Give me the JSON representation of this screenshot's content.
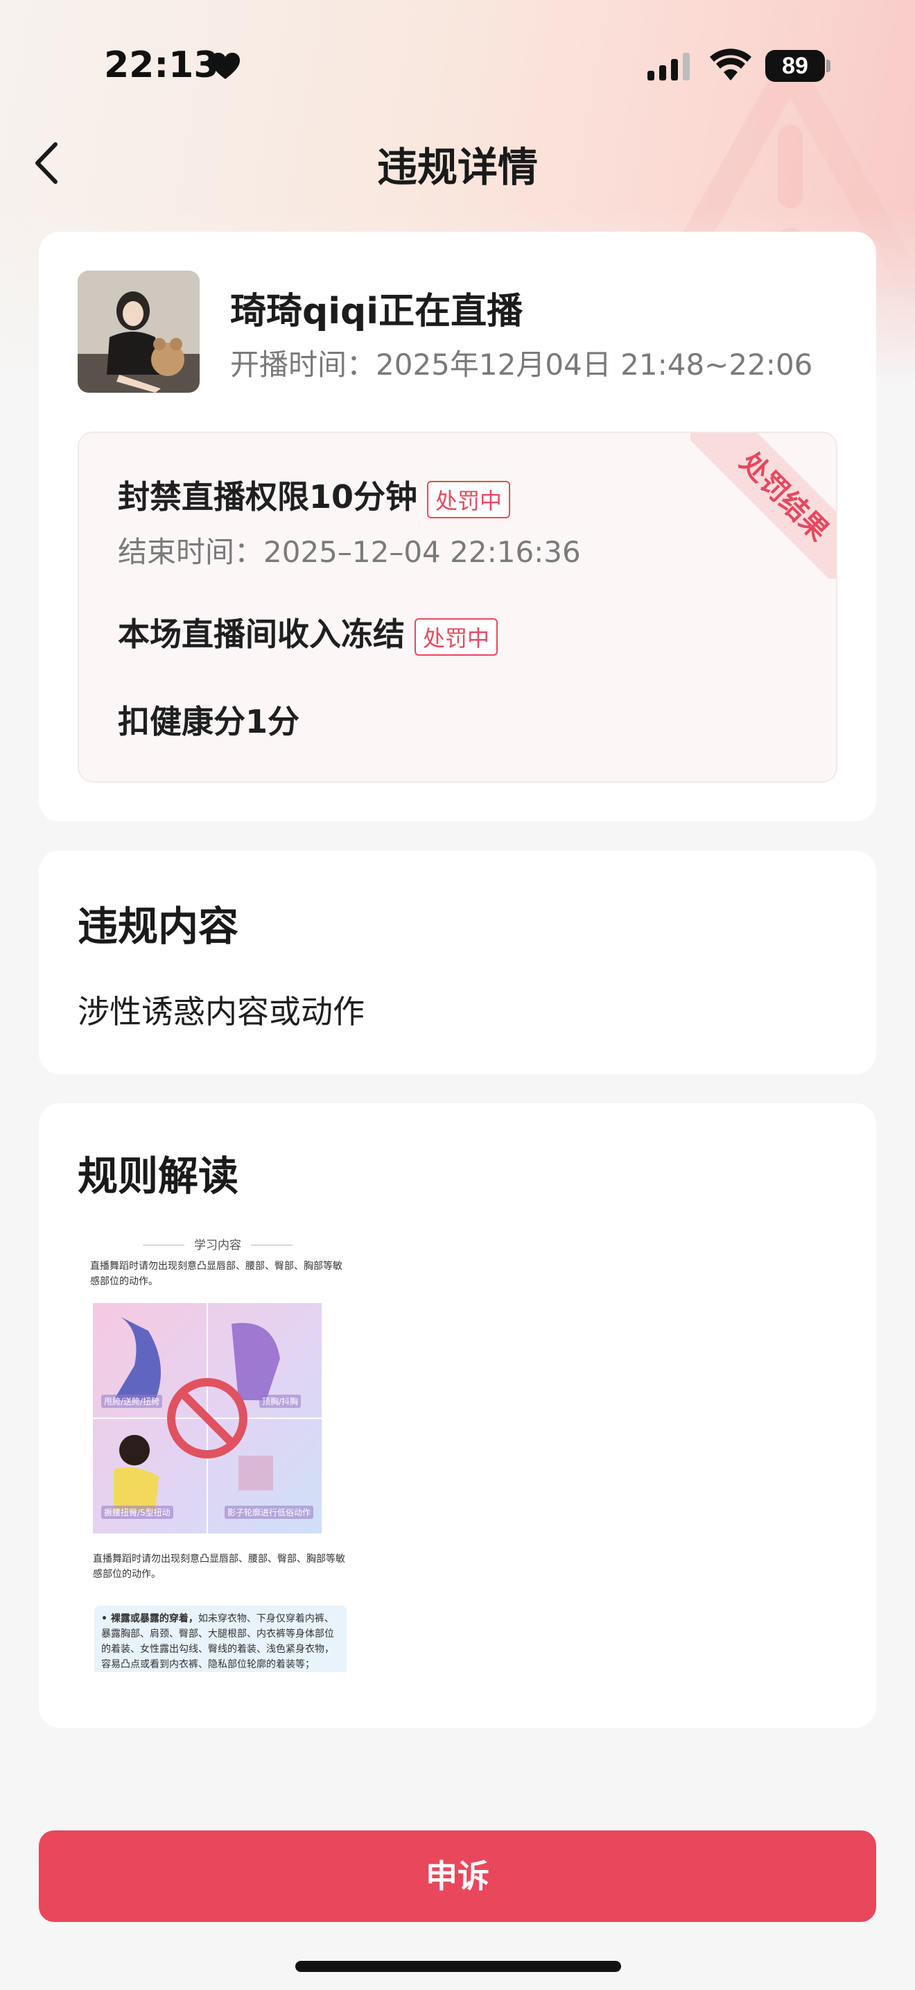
{
  "status_bar": {
    "time": "22:13",
    "battery": "89"
  },
  "header": {
    "title": "违规详情"
  },
  "live": {
    "anchor_title": "琦琦qiqi正在直播",
    "live_time": "开播时间：2025年12月04日 21:48~22:06"
  },
  "penalty": {
    "ribbon": "处罚结果",
    "items": [
      {
        "label": "封禁直播权限10分钟",
        "badge": "处罚中",
        "end_time": "结束时间：2025–12–04 22:16:36"
      },
      {
        "label": "本场直播间收入冻结",
        "badge": "处罚中"
      },
      {
        "label": "扣健康分1分"
      }
    ]
  },
  "violation": {
    "title": "违规内容",
    "content": "涉性诱惑内容或动作"
  },
  "rules": {
    "title": "规则解读",
    "image": {
      "header": "学习内容",
      "text1": "直播舞蹈时请勿出现刻意凸显唇部、腰部、臀部、胸部等敏感部位的动作。",
      "labels": [
        "甩胯/送胯/扭胯",
        "顶胸/抖胸",
        "撅腰扭臀/S型扭动",
        "影子轮廓进行低俗动作"
      ],
      "text2": "直播舞蹈时请勿出现刻意凸显唇部、腰部、臀部、胸部等敏感部位的动作。",
      "box_bold": "• 裸露或暴露的穿着，",
      "box_text": "如未穿衣物、下身仅穿着内裤、暴露胸部、肩颈、臀部、大腿根部、内衣裤等身体部位的着装、女性露出勾线、臀线的着装、浅色紧身衣物，容易凸点或看到内衣裤、隐私部位轮廓的着装等；"
    }
  },
  "footer": {
    "appeal_label": "申诉"
  },
  "colors": {
    "accent": "#e9475c",
    "badge": "#e6485f"
  }
}
